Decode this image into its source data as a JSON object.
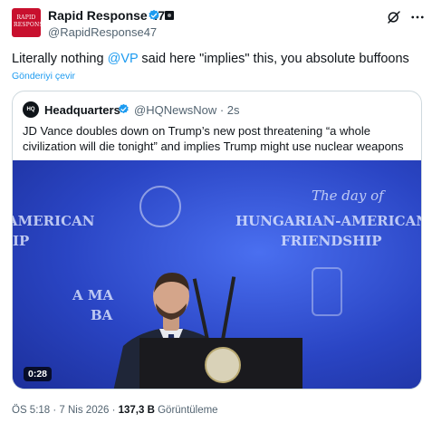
{
  "author": {
    "avatar_line1": "RAPID",
    "avatar_line2": "RESPONSE",
    "name": "Rapid Response 47",
    "handle": "@RapidResponse47"
  },
  "tweet": {
    "text_before": "Literally nothing ",
    "mention": "@VP",
    "text_after": " said here \"implies\" this, you absolute buffoons",
    "translate_label": "Gönderiyi çevir"
  },
  "quote": {
    "avatar_text": "HQ",
    "name": "Headquarters",
    "handle": "@HQNewsNow · 2s",
    "text": "JD Vance doubles down on Trump’s new post threatening “a whole civilization will die tonight” and implies Trump might use nuclear weapons",
    "video": {
      "duration": "0:28",
      "backdrop_line1": "The day of",
      "backdrop_line2": "HUNGARIAN-AMERICAN",
      "backdrop_line3": "FRIENDSHIP",
      "backdrop_left1": "AMERICAN",
      "backdrop_left2": "IP",
      "backdrop_left3": "A MA",
      "backdrop_left4": "BA"
    }
  },
  "meta": {
    "time": "ÖS 5:18 · 7 Nis 2026 · ",
    "views_count": "137,3 B",
    "views_label": " Görüntüleme"
  },
  "icons": {
    "verified": "verified-badge-icon",
    "grok": "grok-icon",
    "more": "more-icon"
  },
  "colors": {
    "accent": "#1d9bf0",
    "text": "#0f1419",
    "muted": "#536471",
    "avatar_red": "#c8102e"
  }
}
